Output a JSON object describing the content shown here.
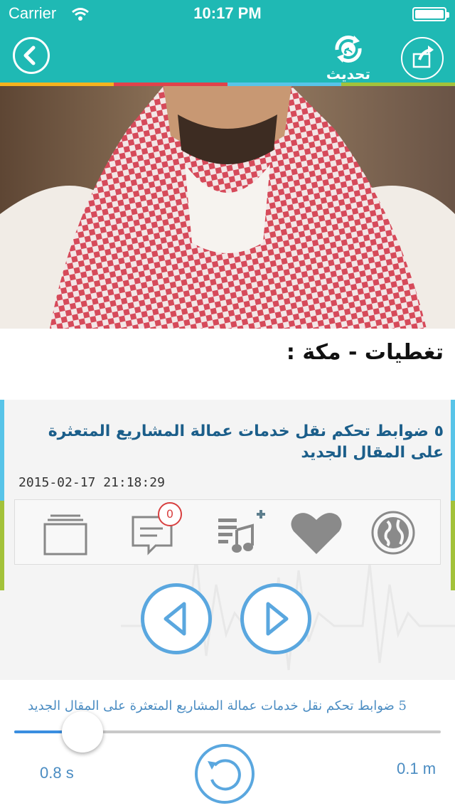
{
  "status_bar": {
    "carrier": "Carrier",
    "time": "10:17 PM"
  },
  "nav": {
    "refresh_label": "تحديث"
  },
  "colors": {
    "teal": "#1fb9b4",
    "accent_blue": "#5aa7df",
    "headline_blue": "#1b5e8a",
    "strip": [
      "#f5b21e",
      "#e0434b",
      "#58c4e8",
      "#a3c23a"
    ]
  },
  "section": {
    "title": "تغطيات - مكة :"
  },
  "article": {
    "headline": "٥ ضوابط تحكم نقل خدمات عمالة المشاريع المتعثرة على المقال الجديد",
    "timestamp": "2015-02-17 21:18:29",
    "comment_count": "0"
  },
  "actions": {
    "icons": [
      "archive-icon",
      "comment-icon",
      "add-to-playlist-icon",
      "heart-icon",
      "globe-icon"
    ]
  },
  "player": {
    "now_playing": "5 ضوابط تحكم نقل خدمات عمالة المشاريع المتعثرة على المقال الجديد",
    "elapsed": "0.8 s",
    "remaining": "0.1 m",
    "progress": 0.16
  }
}
